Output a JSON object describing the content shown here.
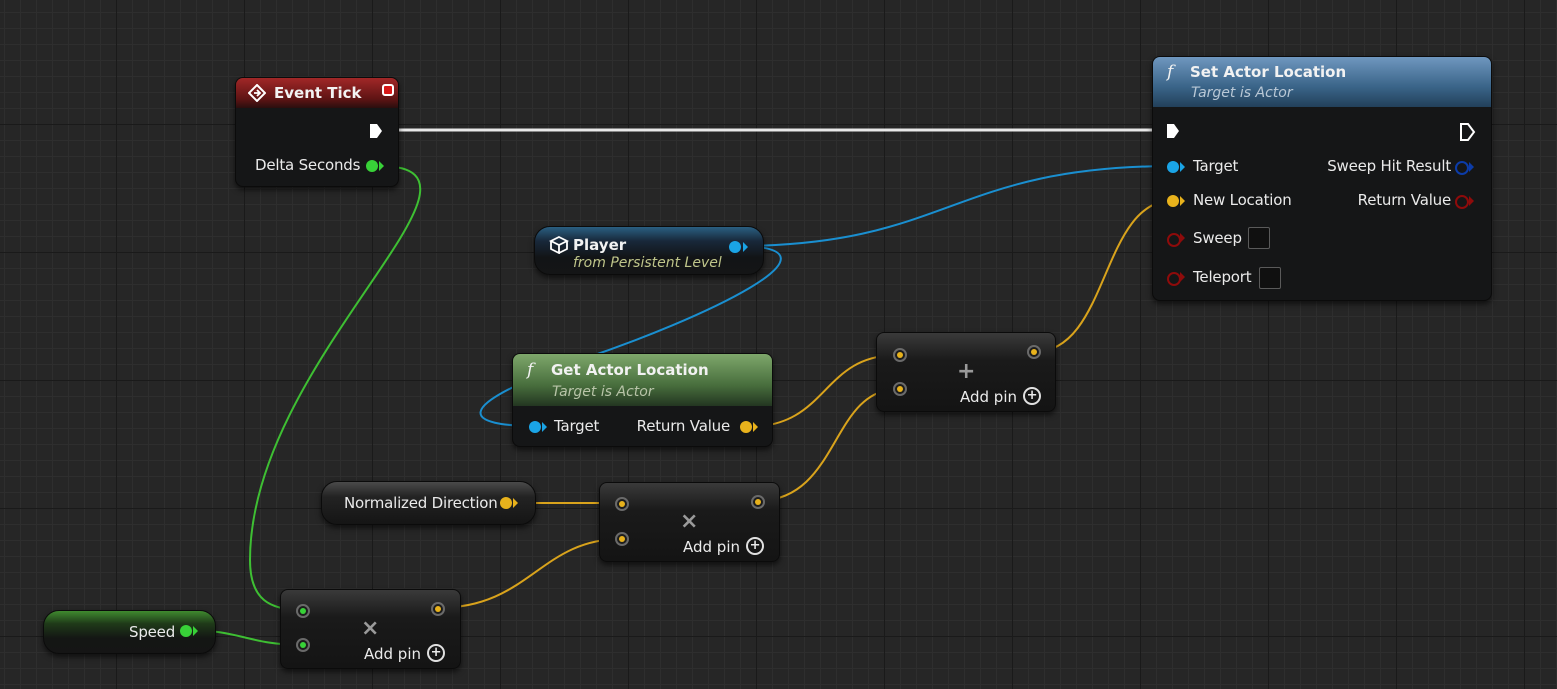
{
  "colors": {
    "exec": "#ffffff",
    "float": "#38d138",
    "vector": "#e8b21c",
    "object": "#1aa4e6",
    "bool": "#8e0b0b",
    "struct": "#0c3ca8"
  },
  "event_tick": {
    "title": "Event Tick",
    "icon": "event-diamond-icon",
    "delta_seconds": "Delta Seconds"
  },
  "set_actor_location": {
    "title": "Set Actor Location",
    "subtitle": "Target is Actor",
    "target": "Target",
    "new_location": "New Location",
    "sweep": "Sweep",
    "teleport": "Teleport",
    "sweep_hit_result": "Sweep Hit Result",
    "return_value": "Return Value"
  },
  "player": {
    "title": "Player",
    "subtitle": "from Persistent Level",
    "icon": "actor-cube-icon"
  },
  "get_actor_location": {
    "title": "Get Actor Location",
    "subtitle": "Target is Actor",
    "target": "Target",
    "return_value": "Return Value"
  },
  "add_node": {
    "symbol": "+",
    "add_pin": "Add pin"
  },
  "multiply_top": {
    "symbol": "×",
    "add_pin": "Add pin"
  },
  "multiply_bottom": {
    "symbol": "×",
    "add_pin": "Add pin"
  },
  "normalized_direction": {
    "label": "Normalized Direction"
  },
  "speed": {
    "label": "Speed"
  },
  "function_symbol": "f",
  "plus_symbol": "+"
}
